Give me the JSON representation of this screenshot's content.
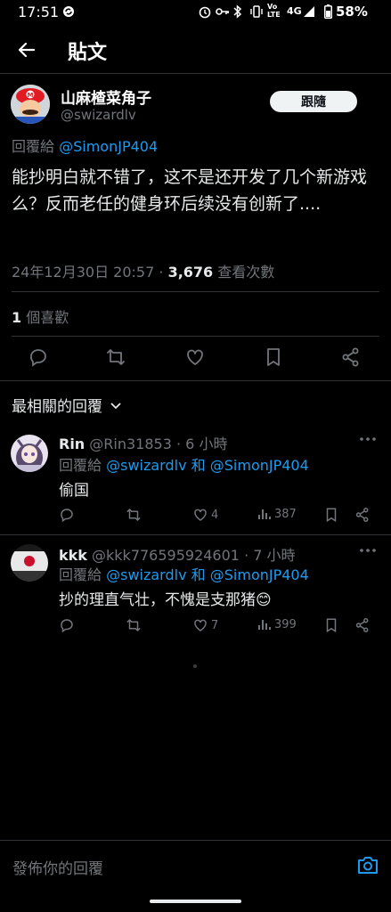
{
  "status_bar": {
    "time": "17:51",
    "network": "4G",
    "battery": "58%"
  },
  "header": {
    "title": "貼文"
  },
  "post": {
    "display_name": "山麻楂菜角子",
    "handle": "@swizardlv",
    "follow_label": "跟隨",
    "reply_prefix": "回覆給",
    "reply_to": "@SimonJP404",
    "text": "能抄明白就不错了，这不是还开发了几个新游戏么？反而老任的健身环后续没有创新了....",
    "timestamp": "24年12月30日 20:57",
    "separator": "·",
    "views": "3,676",
    "views_label": "查看次數",
    "likes_count": "1",
    "likes_label": "個喜歡"
  },
  "replies_header": {
    "label": "最相關的回覆"
  },
  "replies": [
    {
      "name": "Rin",
      "handle": "@Rin31853",
      "time": "· 6 小時",
      "reply_prefix": "回覆給",
      "to1": "@swizardlv",
      "and": "和",
      "to2": "@SimonJP404",
      "text": "偷国",
      "likes": "4",
      "views": "387"
    },
    {
      "name": "kkk",
      "handle": "@kkk776595924601",
      "time": "· 7 小時",
      "reply_prefix": "回覆給",
      "to1": "@swizardlv",
      "and": "和",
      "to2": "@SimonJP404",
      "text": "抄的理直气壮，不愧是支那猪😊",
      "likes": "7",
      "views": "399"
    }
  ],
  "composer": {
    "placeholder": "發佈你的回覆"
  },
  "colors": {
    "background": "#000000",
    "accent": "#1d9bf0",
    "muted": "#71767b",
    "text": "#e7e9ea",
    "divider": "#2f3336"
  }
}
